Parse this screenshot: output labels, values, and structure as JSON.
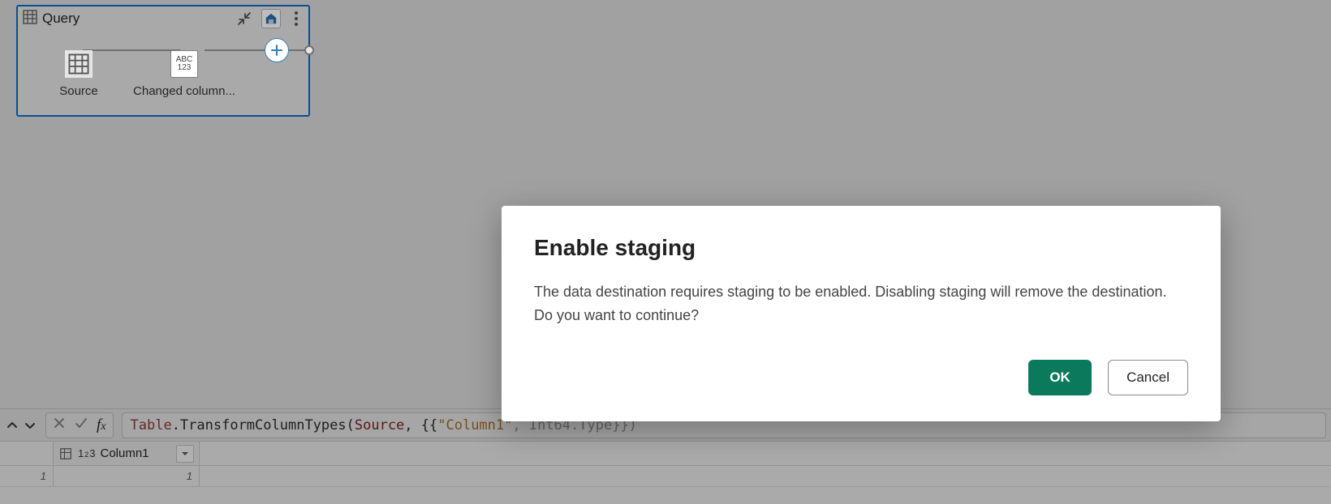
{
  "query_card": {
    "title": "Query",
    "steps": [
      {
        "label": "Source",
        "icon": "table-icon"
      },
      {
        "label": "Changed column...",
        "icon": "type-icon",
        "type_text_top": "ABC",
        "type_text_bottom": "123"
      }
    ]
  },
  "formula_bar": {
    "expression_plain": "Table.TransformColumnTypes(Source, {{\"Column1\", Int64.Type}})",
    "kw": "Table",
    "fn": ".TransformColumnTypes",
    "arg1": "Source",
    "str": "\"Column1\"",
    "rest": ", Int64.Type}})"
  },
  "grid": {
    "column_name": "Column1",
    "column_type_label": "1²3",
    "row_number": "1",
    "cell_value": "1"
  },
  "dialog": {
    "title": "Enable staging",
    "body": "The data destination requires staging to be enabled. Disabling staging will remove the destination. Do you want to continue?",
    "ok_label": "OK",
    "cancel_label": "Cancel"
  },
  "icons": {
    "collapse": "collapse-icon",
    "destination": "destination-icon",
    "more": "more-icon",
    "add": "add-icon",
    "chevron_up": "chevron-up-icon",
    "chevron_down": "chevron-down-icon",
    "cancel_x": "cancel-icon",
    "commit_check": "commit-icon",
    "fx": "fx-icon",
    "dropdown": "dropdown-icon",
    "table": "table-icon"
  }
}
